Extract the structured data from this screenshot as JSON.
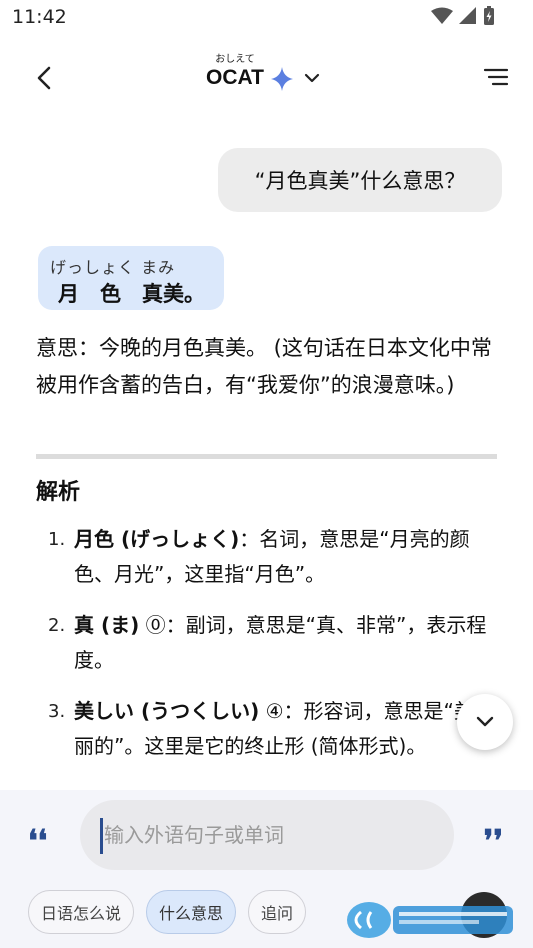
{
  "status_bar": {
    "time": "11:42"
  },
  "header": {
    "title": "OCAT",
    "title_ruby": "おしえて",
    "icons": {
      "back": "back-arrow-icon",
      "sparkle": "sparkle-icon",
      "dropdown": "chevron-down-icon",
      "menu": "menu-icon"
    }
  },
  "chat": {
    "user_message": "“月色真美”什么意思？",
    "ruby": {
      "reading": "げっしょく まみ",
      "text": "月　色　真美。"
    },
    "meaning": "意思：今晚的月色真美。 (这句话在日本文化中常被用作含蓄的告白，有“我爱你”的浪漫意味。)",
    "section_title": "解析",
    "definitions": [
      {
        "num": "1.",
        "term": "月色 (げっしょく)",
        "text": "：名词，意思是“月亮的颜色、月光”，这里指“月色”。"
      },
      {
        "num": "2.",
        "term": "真 (ま)",
        "text": " ⓪：副词，意思是“真、非常”，表示程度。"
      },
      {
        "num": "3.",
        "term": "美しい (うつくしい)",
        "text": " ④：形容词，意思是“美丽的”。这里是它的终止形 (简体形式)。"
      }
    ]
  },
  "input": {
    "placeholder": "输入外语句子或单词",
    "value": ""
  },
  "chips": [
    "日语怎么说",
    "什么意思",
    "追问"
  ],
  "colors": {
    "accent": "#2a4d8f",
    "bubble_user": "#ececec",
    "ruby_card": "#dbe8fb",
    "sparkle": "#5b7fe0"
  }
}
